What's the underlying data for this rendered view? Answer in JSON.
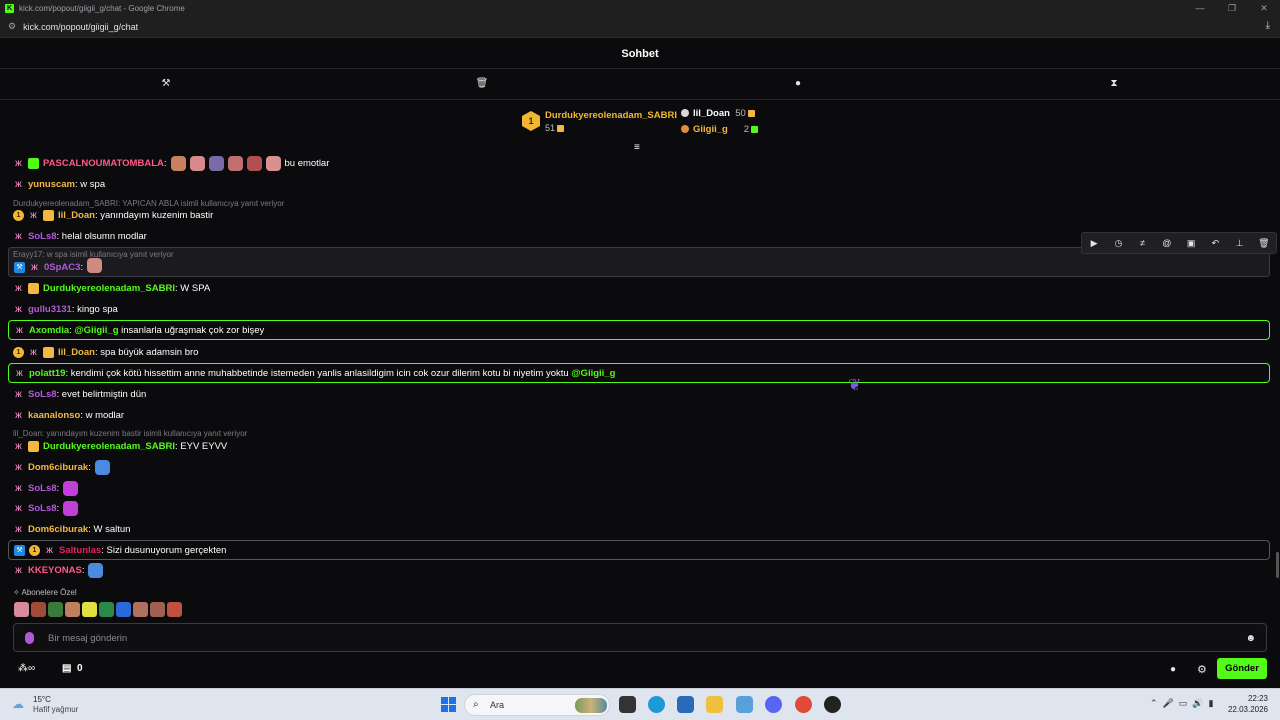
{
  "window": {
    "title": "kick.com/popout/giigii_g/chat - Google Chrome",
    "url": "kick.com/popout/giigii_g/chat"
  },
  "chat": {
    "header": "Sohbet",
    "leaderboard": [
      {
        "rank": "1",
        "name": "Durdukyereolenadam_SABRI",
        "value": "51"
      },
      {
        "name": "lil_Doan",
        "value": "50"
      },
      {
        "name": "Giigii_g",
        "value": "2"
      }
    ],
    "messages": [
      {
        "user": "PASCALNOUMATOMBALA",
        "text": "bu emotlar",
        "color": "#ff5a8a"
      },
      {
        "user": "yunuscam",
        "text": "w spa",
        "color": "#f4b841"
      },
      {
        "reply": "Durdukyereolenadam_SABRI: YAPICAN ABLA isimli kullanıcıya yanıt veriyor"
      },
      {
        "user": "lil_Doan",
        "text": "yanındayım kuzenim bastir",
        "color": "#f4b841"
      },
      {
        "user": "SoLs8",
        "text": "helal olsumn modlar",
        "color": "#b05ad8"
      },
      {
        "reply": "Erayy17: w spa isimli kullanıcıya yanıt veriyor"
      },
      {
        "user": "0SpAC3",
        "text": "",
        "color": "#b05ad8"
      },
      {
        "user": "Durdukyereolenadam_SABRI",
        "text": "W SPA",
        "color": "#53fc18"
      },
      {
        "user": "gullu3131",
        "text": "kingo spa",
        "color": "#b05ad8"
      },
      {
        "user": "Axomdia",
        "text": " insanlarla uğraşmak çok zor bişey",
        "mention": "@Giigii_g",
        "color": "#53fc18"
      },
      {
        "user": "lil_Doan",
        "text": "spa büyük adamsin bro",
        "color": "#f4b841"
      },
      {
        "user": "polatt19",
        "text": "kendimi çok kötü hissettim anne muhabbetinde istemeden yanlis anlasildigim icin cok ozur dilerim kotu bi niyetim yoktu ",
        "mention": "@Giigii_g",
        "color": "#53fc18"
      },
      {
        "user": "SoLs8",
        "text": "evet belirtmiştin dün",
        "color": "#b05ad8"
      },
      {
        "user": "kaanalonso",
        "text": "w modlar",
        "color": "#f4b841"
      },
      {
        "reply": "lil_Doan: yanındayım kuzenim bastir isimli kullanıcıya yanıt veriyor"
      },
      {
        "user": "Durdukyereolenadam_SABRI",
        "text": "EYV EYVV",
        "color": "#53fc18"
      },
      {
        "user": "Dom6ciburak",
        "text": "",
        "color": "#f4b841"
      },
      {
        "user": "SoLs8",
        "text": "",
        "color": "#b05ad8"
      },
      {
        "user": "SoLs8",
        "text": "",
        "color": "#b05ad8"
      },
      {
        "user": "Dom6ciburak",
        "text": "W saltun",
        "color": "#f4b841"
      },
      {
        "user": "Saltunlas",
        "text": "Sizi dusunuyorum gerçekten",
        "color": "#e0245e"
      },
      {
        "user": "KKEYONAS",
        "text": "",
        "color": "#ff5a8a"
      }
    ],
    "subs_only": "Abonelere Özel",
    "input_placeholder": "Bir mesaj gönderin",
    "store_count": "0",
    "send_label": "Gönder"
  },
  "taskbar": {
    "temperature": "15°C",
    "condition": "Hafif yağmur",
    "search_label": "Ara",
    "time": "22:23",
    "date": "22.03.2026"
  },
  "colors": {
    "accent": "#53fc18",
    "gold": "#f1b733",
    "background": "#0b0b0d"
  }
}
